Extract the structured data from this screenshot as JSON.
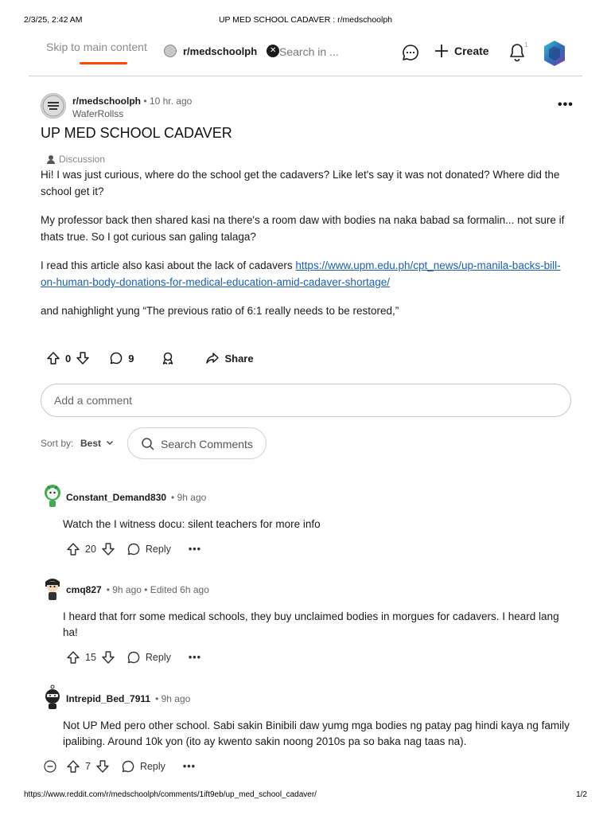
{
  "print": {
    "date": "2/3/25, 2:42 AM",
    "doc_title": "UP MED SCHOOL CADAVER : r/medschoolph",
    "url": "https://www.reddit.com/r/medschoolph/comments/1ift9eb/up_med_school_cadaver/",
    "page": "1/2"
  },
  "topbar": {
    "skip_link": "Skip to main content",
    "subreddit_chip": "r/medschoolph",
    "search_placeholder": "Search in ...",
    "create_label": "Create",
    "notification_count": "1",
    "accent_color": "#ff4500"
  },
  "post": {
    "subreddit": "r/medschoolph",
    "age": "10 hr. ago",
    "author": "WaferRollss",
    "subreddit_avatar_text": "MED SCHOOL PH",
    "title": "UP MED SCHOOL CADAVER",
    "flair": "Discussion",
    "body": {
      "p1": "Hi! I was just curious, where do the school get the cadavers? Like let's say it was not donated? Where did the school get it?",
      "p2": "My professor back then shared kasi na there's a room daw with bodies na naka babad sa formalin... not sure if thats true. So I got curious san galing talaga?",
      "p3_text": "I read this article also kasi about the lack of cadavers ",
      "p3_link": "https://www.upm.edu.ph/cpt_news/up-manila-backs-bill-on-human-body-donations-for-medical-education-amid-cadaver-shortage/",
      "p4": "and nahighlight yung “The previous ratio of 6:1 really needs to be restored,”"
    },
    "votes": "0",
    "comments": "9",
    "share_label": "Share",
    "more_label": "•••"
  },
  "comment_box": {
    "placeholder": "Add a comment"
  },
  "sort": {
    "label": "Sort by:",
    "value": "Best",
    "search_label": "Search Comments"
  },
  "comments": [
    {
      "user": "Constant_Demand830",
      "when": "• 9h ago",
      "text": "Watch the I witness docu: silent teachers for more info",
      "votes": "20",
      "reply": "Reply",
      "more": "•••"
    },
    {
      "user": "cmq827",
      "when": "• 9h ago • Edited 6h ago",
      "text": "I heard that forr some medical schools, they buy unclaimed bodies in morgues for cadavers. I heard lang ha!",
      "votes": "15",
      "reply": "Reply",
      "more": "•••"
    },
    {
      "user": "Intrepid_Bed_7911",
      "when": "• 9h ago",
      "text": "Not UP Med pero other school. Sabi sakin Binibili daw yumg mga bodies ng patay pag hindi kaya ng family ipalibing. Around 10k yon (ito ay kwento sakin noong 2010s pa so baka nag taas na).",
      "votes": "7",
      "reply": "Reply",
      "more": "•••"
    }
  ]
}
